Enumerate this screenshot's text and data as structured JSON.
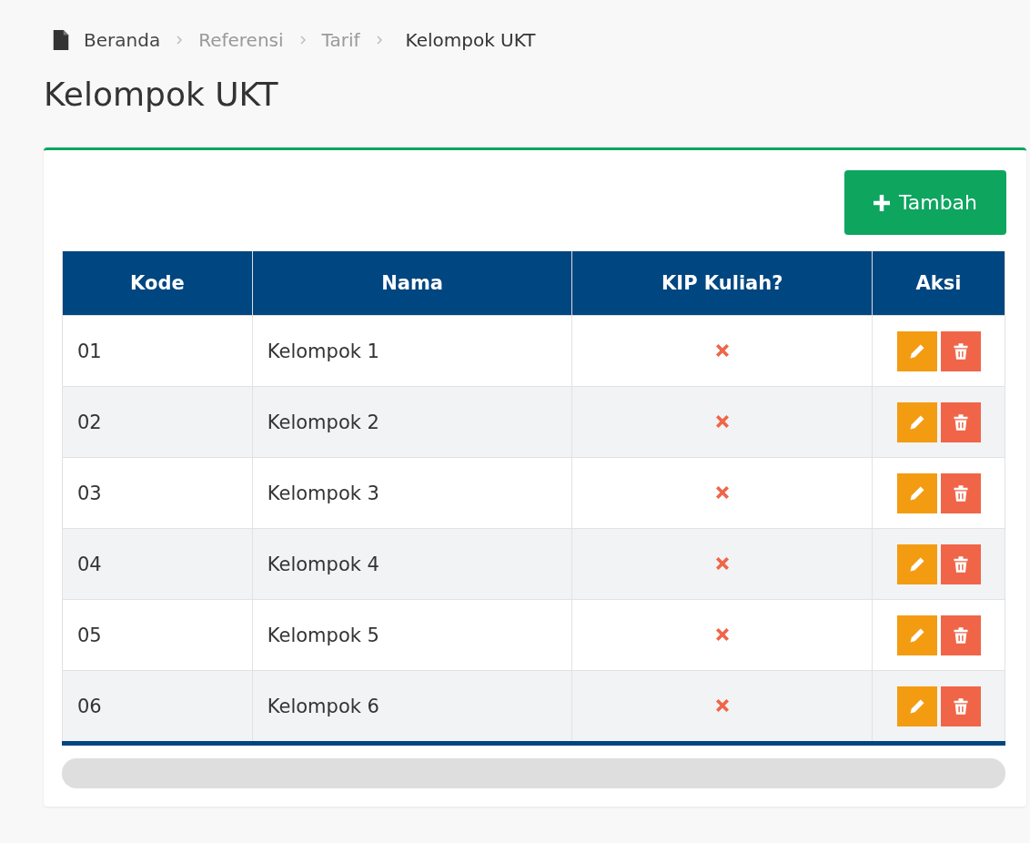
{
  "breadcrumb": [
    {
      "label": "Beranda",
      "kind": "home"
    },
    {
      "label": "Referensi",
      "kind": "link"
    },
    {
      "label": "Tarif",
      "kind": "link"
    },
    {
      "label": "Kelompok UKT",
      "kind": "current"
    }
  ],
  "page_title": "Kelompok UKT",
  "add_button": {
    "label": "Tambah"
  },
  "table": {
    "columns": [
      "Kode",
      "Nama",
      "KIP Kuliah?",
      "Aksi"
    ],
    "rows": [
      {
        "kode": "01",
        "nama": "Kelompok 1",
        "kip_kuliah": false
      },
      {
        "kode": "02",
        "nama": "Kelompok 2",
        "kip_kuliah": false
      },
      {
        "kode": "03",
        "nama": "Kelompok 3",
        "kip_kuliah": false
      },
      {
        "kode": "04",
        "nama": "Kelompok 4",
        "kip_kuliah": false
      },
      {
        "kode": "05",
        "nama": "Kelompok 5",
        "kip_kuliah": false
      },
      {
        "kode": "06",
        "nama": "Kelompok 6",
        "kip_kuliah": false
      }
    ]
  }
}
